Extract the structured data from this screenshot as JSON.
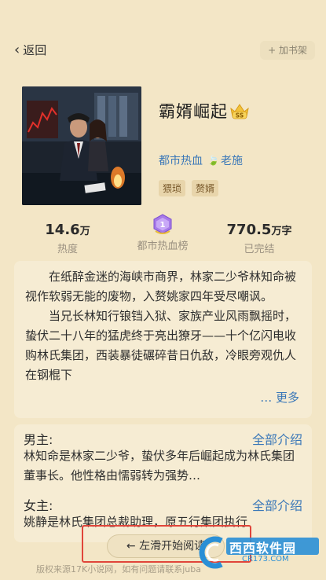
{
  "topbar": {
    "back_label": "返回",
    "shelf_label": "+ 加书架"
  },
  "book": {
    "title": "霸婿崛起",
    "badge": "SS",
    "category": "都市热血",
    "author": "老施",
    "tags": [
      "猥琐",
      "赘婿"
    ]
  },
  "stats": {
    "popularity_value": "14.6",
    "popularity_unit": "万",
    "popularity_label": "热度",
    "rank_number": "1",
    "rank_label": "都市热血榜",
    "words_value": "770.5",
    "words_unit": "万字",
    "status_label": "已完结"
  },
  "description": {
    "paragraphs": [
      "在纸醉金迷的海峡市商界，林家二少爷林知命被视作软弱无能的废物，入赘姚家四年受尽嘲讽。",
      "当兄长林知行锒铛入狱、家族产业风雨飘摇时，蛰伏二十八年的猛虎终于亮出獠牙——十个亿闪电收购林氏集团，西装暴徒碾碎昔日仇敌，冷眼旁观仇人在钢棍下"
    ],
    "more_label": "更多"
  },
  "characters": {
    "male_label": "男主:",
    "male_link": "全部介绍",
    "male_text": "林知命是林家二少爷，蛰伏多年后崛起成为林氏集团董事长。他性格由懦弱转为强势…",
    "female_label": "女主:",
    "female_link": "全部介绍",
    "female_text": "姚静是林氏集团总裁助理，原五行集团执行"
  },
  "footer": {
    "slide_label": "← 左滑开始阅读",
    "copyright": "版权来源17K小说网，如有问题请联系juba"
  },
  "watermark": {
    "brand": "西西软件园",
    "domain": "CR173.COM"
  },
  "colors": {
    "background": "#f3e6c6",
    "link": "#3b78b8",
    "highlight_box": "#e0453a"
  }
}
